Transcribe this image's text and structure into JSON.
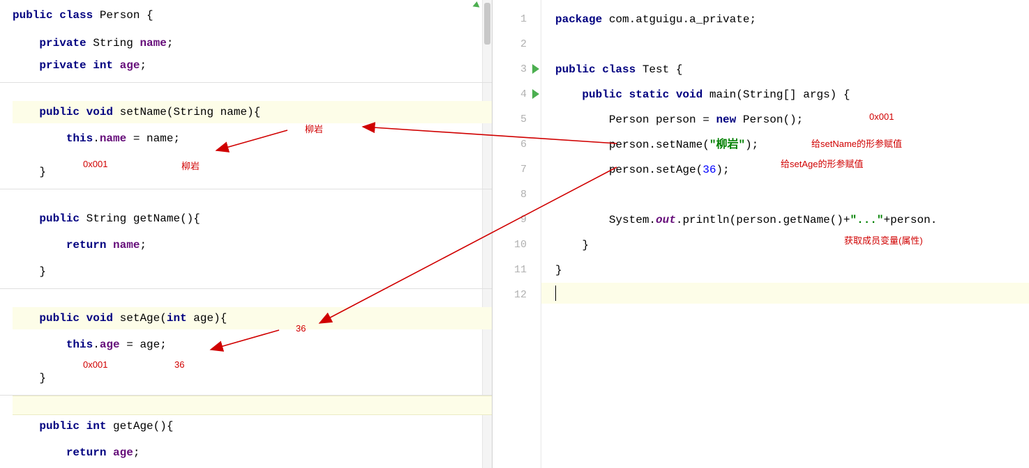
{
  "left": {
    "l1": "public class Person {",
    "l2": "    private String name;",
    "l3": "    private int age;",
    "l4": "    public void setName(String name){",
    "l5": "        this.name = name;",
    "l6": "    }",
    "l7": "    public String getName(){",
    "l8": "        return name;",
    "l9": "    }",
    "l10": "    public void setAge(int age){",
    "l11": "        this.age = age;",
    "l12": "    }",
    "l13": "    public int getAge(){",
    "l14": "        return age;"
  },
  "right": {
    "n1": "1",
    "n2": "2",
    "n3": "3",
    "n4": "4",
    "n5": "5",
    "n6": "6",
    "n7": "7",
    "n8": "8",
    "n9": "9",
    "n10": "10",
    "n11": "11",
    "n12": "12",
    "r1_a": "package",
    "r1_b": " com.atguigu.a_private;",
    "r3_a": "public class",
    "r3_b": " Test {",
    "r4_a": "    public static void",
    "r4_b": " main(String[] args) {",
    "r5_a": "        Person person = ",
    "r5_b": "new",
    "r5_c": " Person();",
    "r6_a": "        person.setName(",
    "r6_b": "\"柳岩\"",
    "r6_c": ");",
    "r7_a": "        person.setAge(",
    "r7_b": "36",
    "r7_c": ");",
    "r9_a": "        System.",
    "r9_b": "out",
    "r9_c": ".println(person.getName()+",
    "r9_d": "\"...\"",
    "r9_e": "+person.",
    "r10": "    }",
    "r11": "}"
  },
  "ann": {
    "liuyan_param": "柳岩",
    "addr": "0x001",
    "liuyan_val": "柳岩",
    "age36_param": "36",
    "age36_val": "36",
    "addr2": "0x001",
    "right_0x001": "0x001",
    "setname_cn": "给setName的形参赋值",
    "setage_cn": "给setAge的形参赋值",
    "getter_cn": "获取成员变量(属性)"
  }
}
